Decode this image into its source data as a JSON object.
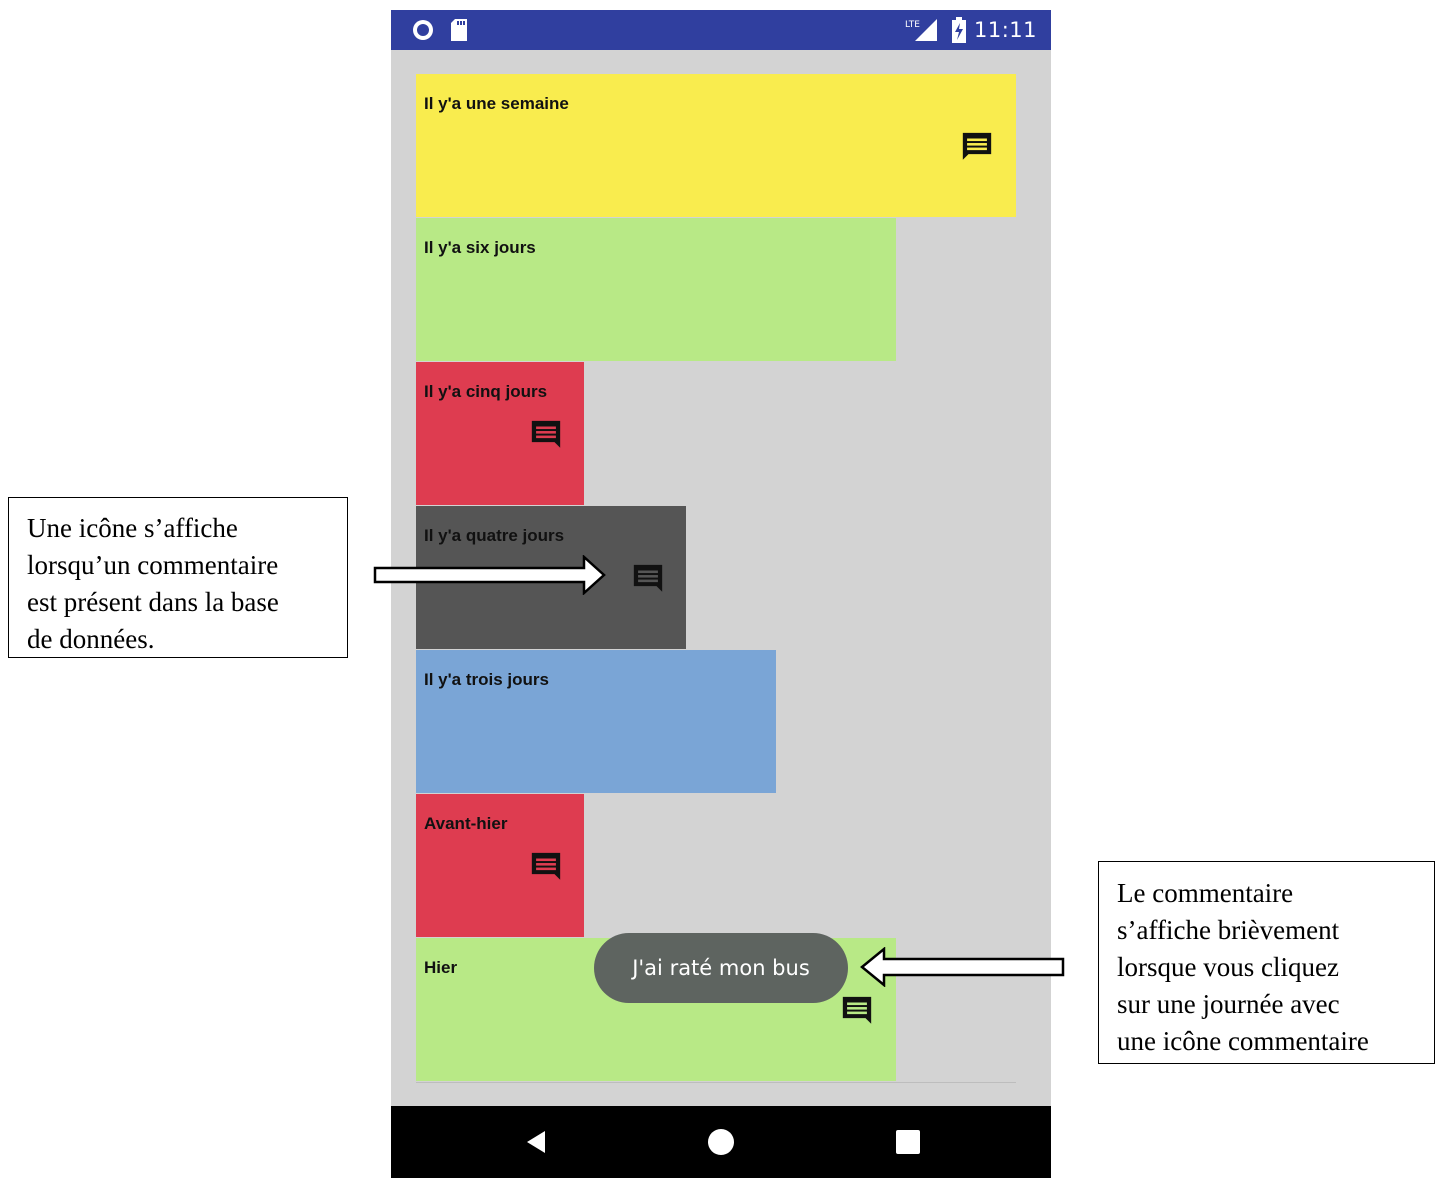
{
  "status_bar": {
    "time": "11:11",
    "network": "LTE",
    "left_icons": [
      "circle-notification-icon",
      "sd-card-icon"
    ],
    "right_icons": [
      "lte-signal-icon",
      "battery-charging-icon"
    ]
  },
  "mood_history": [
    {
      "label": "Il y'a une semaine",
      "color": "#f9ec4e",
      "has_comment": true
    },
    {
      "label": "Il y'a six jours",
      "color": "#b8e986",
      "has_comment": false
    },
    {
      "label": "Il y'a cinq jours",
      "color": "#de3c50",
      "has_comment": true
    },
    {
      "label": "Il y'a quatre jours",
      "color": "#555555",
      "has_comment": true
    },
    {
      "label": "Il y'a trois jours",
      "color": "#7aa5d6",
      "has_comment": false
    },
    {
      "label": "Avant-hier",
      "color": "#de3c50",
      "has_comment": true
    },
    {
      "label": "Hier",
      "color": "#b8e986",
      "has_comment": true
    }
  ],
  "toast": {
    "text": "J'ai raté mon bus"
  },
  "nav_bar": {
    "buttons": [
      "back-icon",
      "home-icon",
      "recents-icon"
    ]
  },
  "annotations": {
    "left": {
      "lines": [
        "Une icône s’affiche",
        "lorsqu’un commentaire",
        "est présent dans la base",
        "de données."
      ]
    },
    "right": {
      "lines": [
        "Le commentaire",
        "s’affiche brièvement",
        "lorsque vous cliquez",
        "sur une journée avec",
        "une icône commentaire"
      ]
    }
  },
  "colors": {
    "status_bar": "#303f9f",
    "background": "#d3d3d3",
    "toast": "#5e6460",
    "nav_bar": "#000000"
  }
}
